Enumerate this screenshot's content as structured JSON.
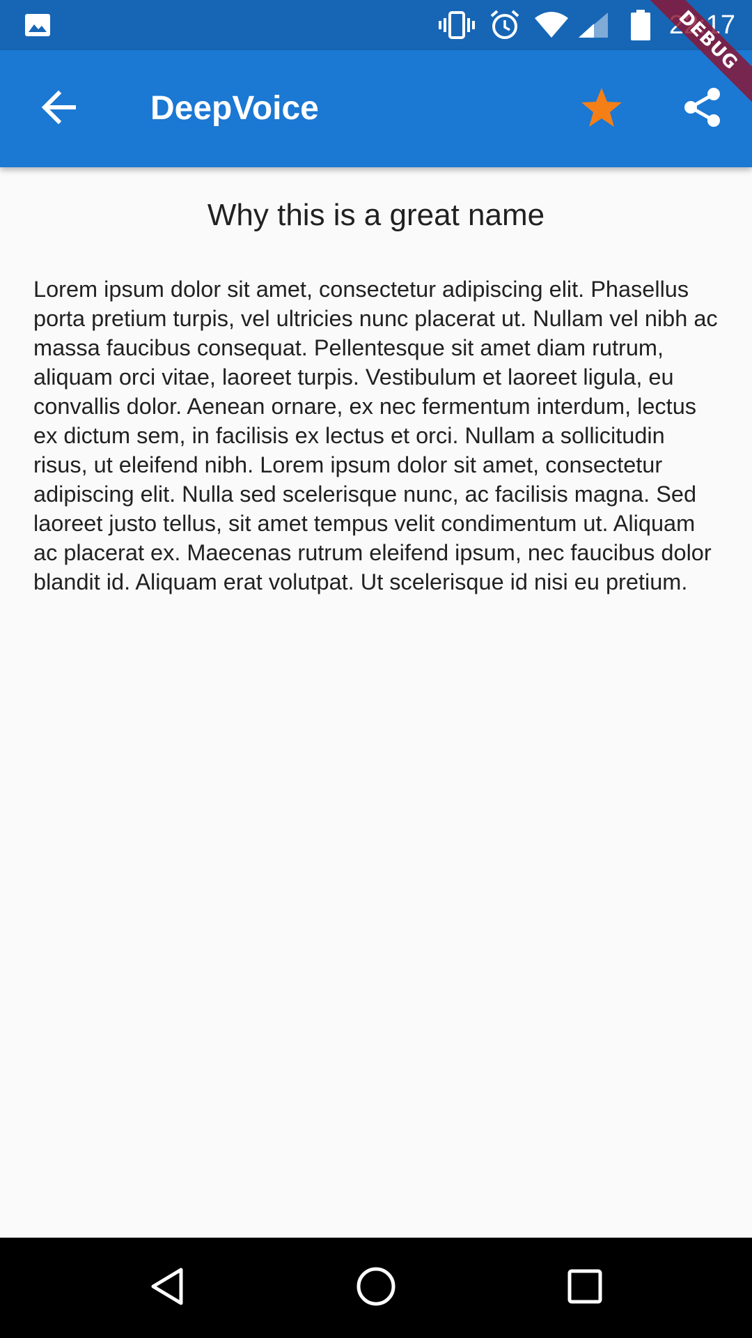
{
  "status_bar": {
    "time": "22:17",
    "icons": [
      "image-notification-icon",
      "vibrate-icon",
      "alarm-icon",
      "wifi-icon",
      "cell-signal-icon",
      "battery-icon"
    ]
  },
  "debug_banner": {
    "label": "DEBUG"
  },
  "app_bar": {
    "title": "DeepVoice",
    "back_icon": "arrow-back-icon",
    "favorite_icon": "star-icon",
    "share_icon": "share-icon",
    "star_color": "#f57f17"
  },
  "content": {
    "heading": "Why this is a great name",
    "body": "Lorem ipsum dolor sit amet, consectetur adipiscing elit. Phasellus porta pretium turpis, vel ultricies nunc placerat ut. Nullam vel nibh ac massa faucibus consequat. Pellentesque sit amet diam rutrum, aliquam orci vitae, laoreet turpis. Vestibulum et laoreet ligula, eu convallis dolor. Aenean ornare, ex nec fermentum interdum, lectus ex dictum sem, in facilisis ex lectus et orci. Nullam a sollicitudin risus, ut eleifend nibh. Lorem ipsum dolor sit amet, consectetur adipiscing elit. Nulla sed scelerisque nunc, ac facilisis magna. Sed laoreet justo tellus, sit amet tempus velit condimentum ut. Aliquam ac placerat ex. Maecenas rutrum eleifend ipsum, nec faucibus dolor blandit id. Aliquam erat volutpat. Ut scelerisque id nisi eu pretium."
  },
  "nav_bar": {
    "icons": [
      "back-triangle-icon",
      "home-circle-icon",
      "recents-square-icon"
    ]
  },
  "colors": {
    "status_bar_bg": "#1766b5",
    "app_bar_bg": "#1b78d3",
    "content_bg": "#fafafa",
    "nav_bar_bg": "#000000"
  }
}
